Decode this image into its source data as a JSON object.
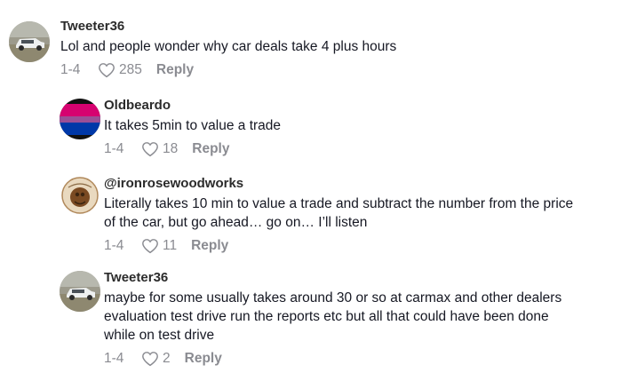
{
  "comments": [
    {
      "username": "Tweeter36",
      "text": [
        "Lol and people wonder why car deals take 4 plus hours"
      ],
      "date": "1-4",
      "likes": "285",
      "reply_label": "Reply",
      "avatar_icon": "car-photo-avatar"
    },
    {
      "username": "Oldbeardo",
      "text": [
        "It takes 5min to value a trade"
      ],
      "date": "1-4",
      "likes": "18",
      "reply_label": "Reply",
      "avatar_icon": "bi-flag-avatar"
    },
    {
      "username": "@ironrosewoodworks",
      "text": [
        "Literally takes 10 min to value a trade and subtract the number from the price",
        "of the car, but go ahead… go on… I’ll listen"
      ],
      "date": "1-4",
      "likes": "11",
      "reply_label": "Reply",
      "avatar_icon": "woodworks-logo-avatar"
    },
    {
      "username": "Tweeter36",
      "text": [
        "maybe for some usually takes around 30 or so at carmax and other dealers",
        "evaluation test drive run the reports etc but all that could have been done",
        "while on test drive"
      ],
      "date": "1-4",
      "likes": "2",
      "reply_label": "Reply",
      "avatar_icon": "car-photo-avatar"
    }
  ],
  "colors": {
    "text": "#161823",
    "muted": "#8a8b91",
    "bi_pink": "#d60270",
    "bi_purple": "#9b4f96",
    "bi_blue": "#0038a8"
  }
}
